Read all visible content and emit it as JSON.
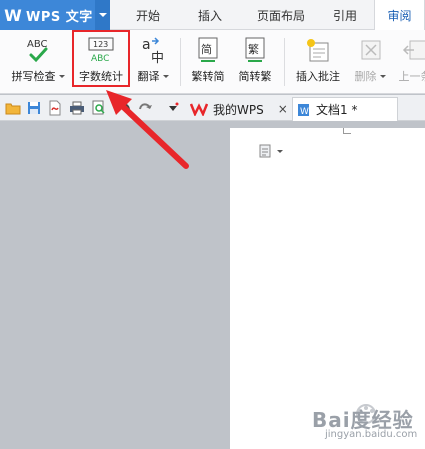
{
  "app": {
    "title": "WPS 文字",
    "logo_letter": "W"
  },
  "tabs": [
    {
      "label": "开始"
    },
    {
      "label": "插入"
    },
    {
      "label": "页面布局"
    },
    {
      "label": "引用"
    },
    {
      "label": "审阅"
    }
  ],
  "ribbon": {
    "spellcheck": {
      "label": "拼写检查",
      "icon_text": "ABC"
    },
    "wordcount": {
      "label": "字数统计",
      "icon_top": "123",
      "icon_bottom": "ABC"
    },
    "translate": {
      "label": "翻译",
      "icon_a": "a",
      "icon_b": "中"
    },
    "trad_to_simp": {
      "label": "繁转简",
      "icon_text": "简"
    },
    "simp_to_trad": {
      "label": "简转繁",
      "icon_text": "繁"
    },
    "insert_comment": {
      "label": "插入批注"
    },
    "delete": {
      "label": "删除"
    },
    "previous": {
      "label": "上一条"
    }
  },
  "doc_tabs": [
    {
      "label": "我的WPS",
      "close": "×"
    },
    {
      "label": "文档1 *"
    }
  ],
  "watermark": {
    "text": "Bai度经验",
    "sub": "jingyan.baidu.com"
  },
  "colors": {
    "brand": "#3d87d8",
    "highlight": "#e8262a",
    "arrow": "#e8262a",
    "workspace": "#bfc3c9"
  }
}
